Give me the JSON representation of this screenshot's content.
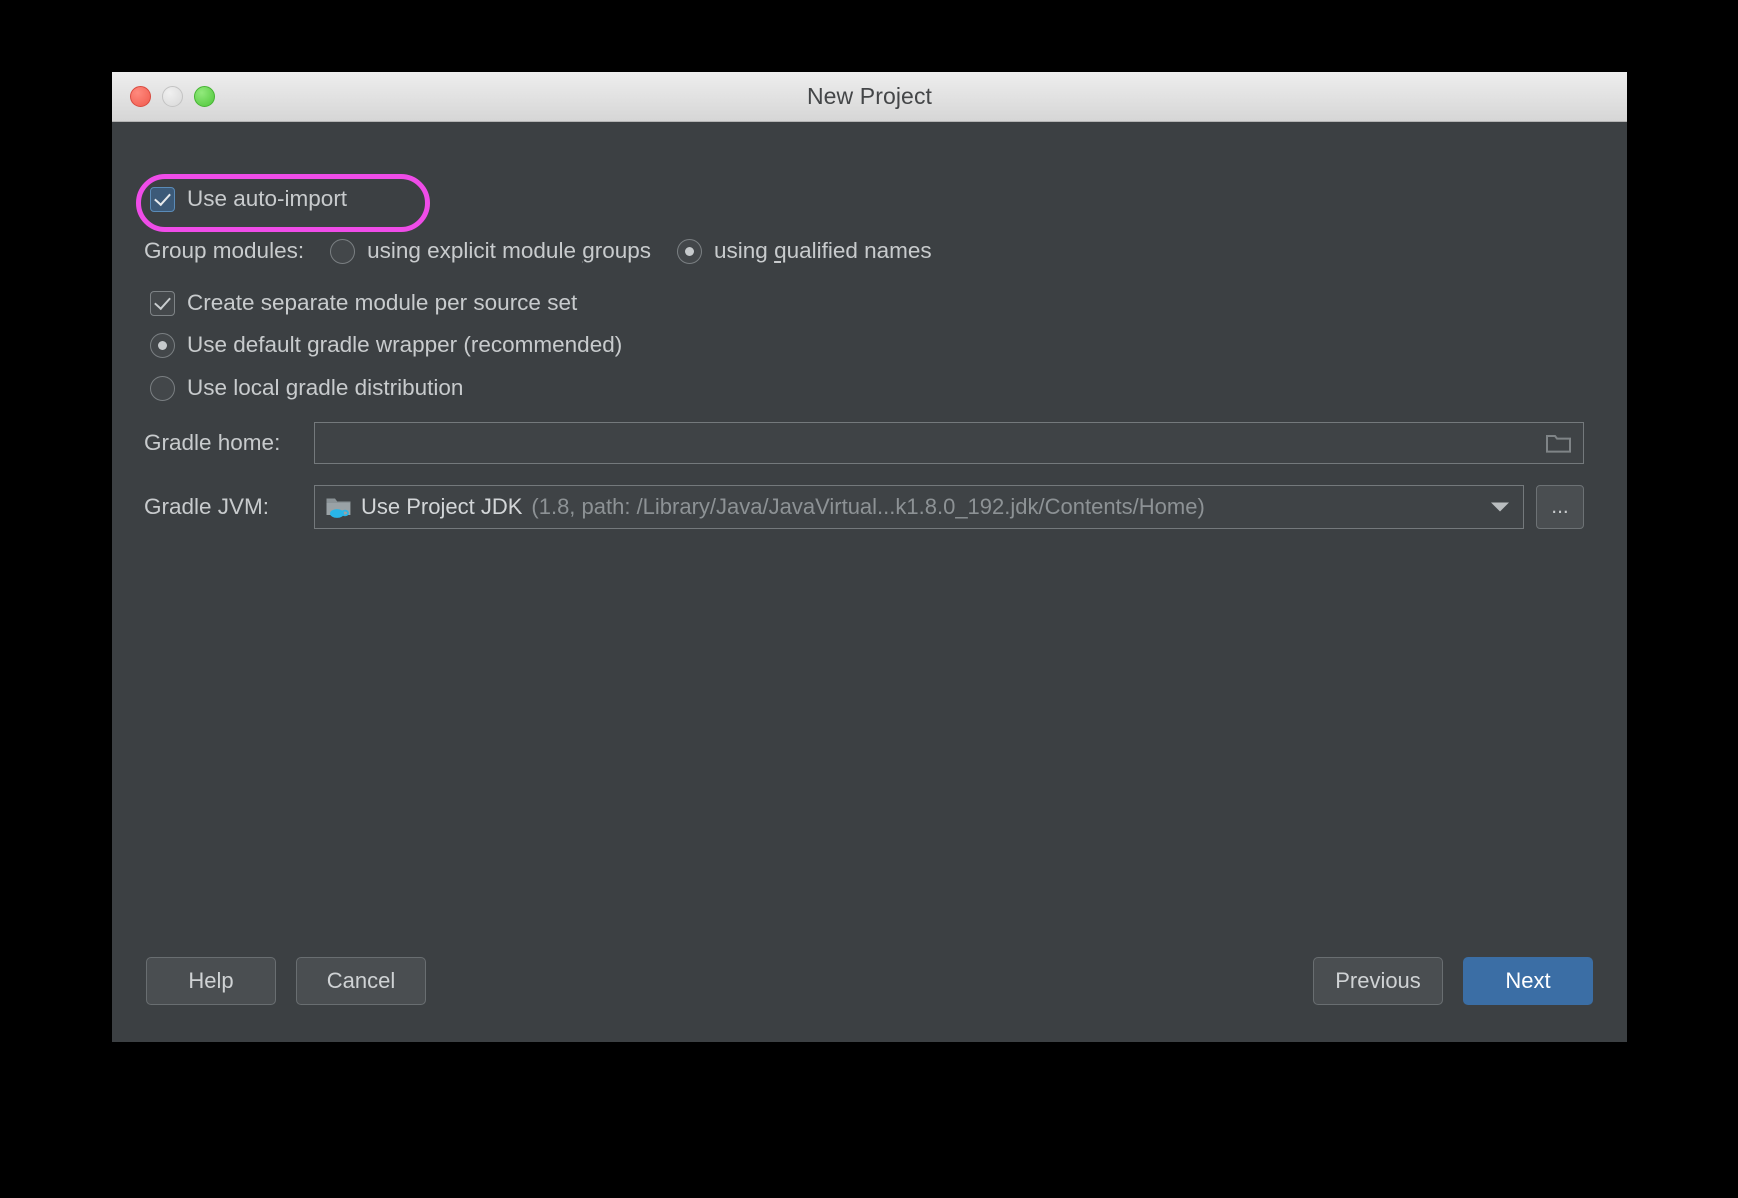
{
  "window": {
    "title": "New Project",
    "traffic_lights": [
      "close-red",
      "minimize-gray",
      "maximize-green"
    ]
  },
  "colors": {
    "window_background": "#3c4043",
    "titlebar_top": "#eeeeee",
    "annotation_highlight": "#ef4ce8",
    "checkbox_checked_blue": "#3c5a78",
    "primary_button": "#3b6ea5",
    "text": "#c8cbcd",
    "text_dim": "#8d9295"
  },
  "form": {
    "auto_import": {
      "label": "Use auto-import",
      "checked": true,
      "highlighted": true
    },
    "group_modules": {
      "label": "Group modules:",
      "options": [
        {
          "label": "using explicit module groups",
          "mnemonic": "g",
          "selected": false
        },
        {
          "label": "using qualified names",
          "mnemonic": "q",
          "selected": true
        }
      ]
    },
    "separate_module": {
      "label": "Create separate module per source set",
      "checked": true
    },
    "gradle_distribution": {
      "options": [
        {
          "label": "Use default gradle wrapper (recommended)",
          "selected": true
        },
        {
          "label": "Use local gradle distribution",
          "selected": false
        }
      ]
    },
    "gradle_home": {
      "label": "Gradle home:",
      "value": "",
      "placeholder": "",
      "browse_icon": "folder-icon"
    },
    "gradle_jvm": {
      "label": "Gradle JVM:",
      "icon": "folder-java-icon",
      "value_main": "Use Project JDK",
      "value_detail": "(1.8, path: /Library/Java/JavaVirtual...k1.8.0_192.jdk/Contents/Home)",
      "dropdown_icon": "chevron-down-icon",
      "more_button": "..."
    }
  },
  "footer": {
    "help": "Help",
    "cancel": "Cancel",
    "previous": "Previous",
    "next": "Next"
  }
}
